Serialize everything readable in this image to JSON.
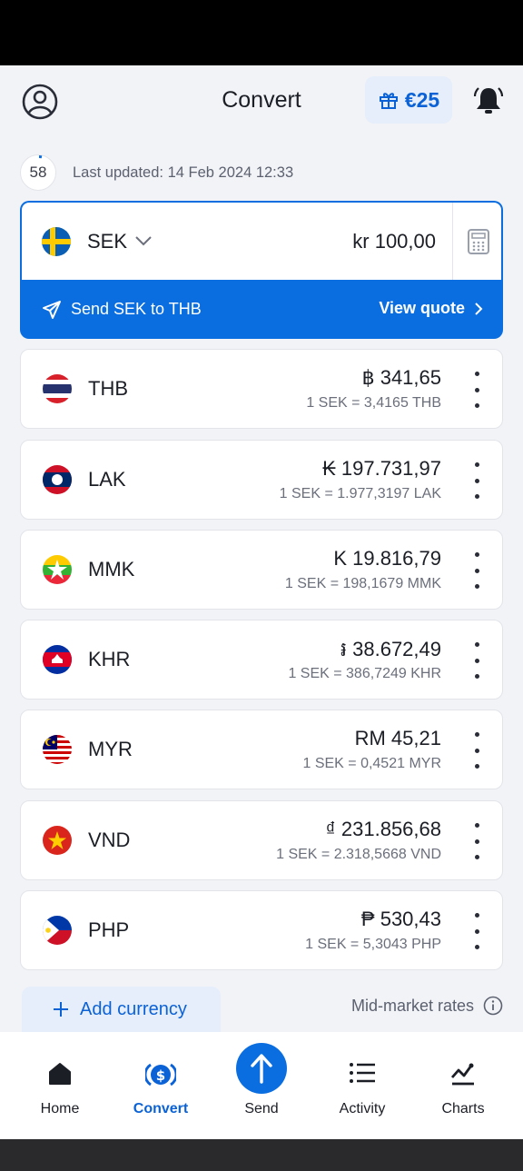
{
  "header": {
    "title": "Convert",
    "reward_amount": "€25"
  },
  "updated": {
    "countdown": "58",
    "text": "Last updated: 14 Feb 2024 12:33"
  },
  "base": {
    "code": "SEK",
    "amount": "kr 100,00",
    "send_text": "Send SEK to THB",
    "quote_label": "View quote"
  },
  "currencies": [
    {
      "code": "THB",
      "value": "฿ 341,65",
      "rate": "1 SEK = 3,4165 THB"
    },
    {
      "code": "LAK",
      "value": "₭ 197.731,97",
      "rate": "1 SEK = 1.977,3197 LAK"
    },
    {
      "code": "MMK",
      "value": "K 19.816,79",
      "rate": "1 SEK = 198,1679 MMK"
    },
    {
      "code": "KHR",
      "value": "៛ 38.672,49",
      "rate": "1 SEK = 386,7249 KHR"
    },
    {
      "code": "MYR",
      "value": "RM 45,21",
      "rate": "1 SEK = 0,4521 MYR"
    },
    {
      "code": "VND",
      "value": "₫ 231.856,68",
      "rate": "1 SEK = 2.318,5668 VND"
    },
    {
      "code": "PHP",
      "value": "₱ 530,43",
      "rate": "1 SEK = 5,3043 PHP"
    }
  ],
  "footer": {
    "add_label": "Add currency",
    "mid_market_label": "Mid-market rates"
  },
  "nav": {
    "home": "Home",
    "convert": "Convert",
    "send": "Send",
    "activity": "Activity",
    "charts": "Charts"
  },
  "colors": {
    "accent": "#0b6ee0",
    "background": "#f2f3f7"
  }
}
